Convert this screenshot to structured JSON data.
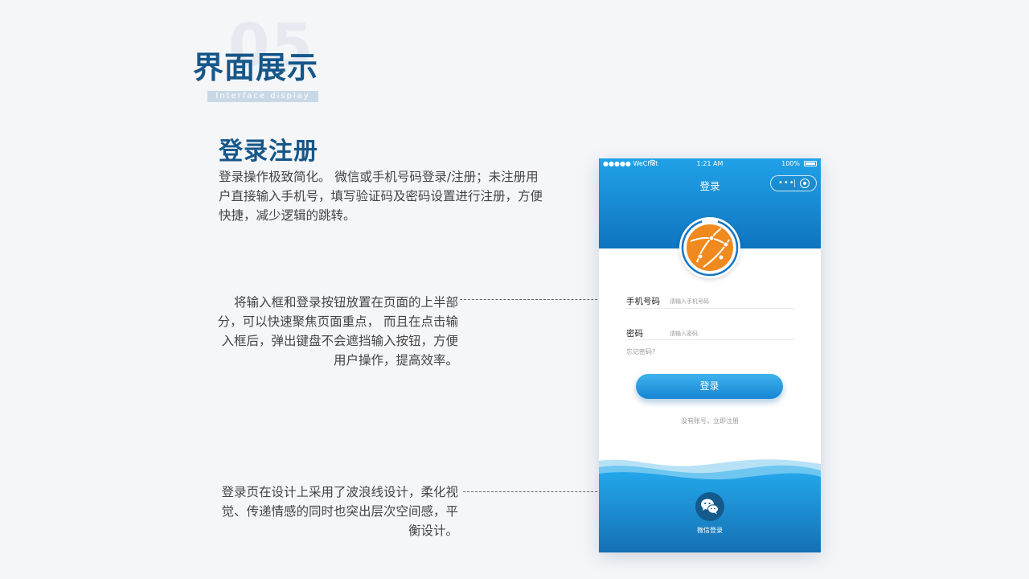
{
  "section": {
    "number": "05",
    "title": "界面展示",
    "subtitle": "Interface display"
  },
  "feature": {
    "title": "登录注册",
    "description": "登录操作极致简化。 微信或手机号码登录/注册；未注册用户直接输入手机号，填写验证码及密码设置进行注册，方便快捷，减少逻辑的跳转。"
  },
  "annotations": [
    {
      "text": "将输入框和登录按钮放置在页面的上半部分，可以快速聚焦页面重点， 而且在点击输入框后，弹出键盘不会遮挡输入按钮，方便用户操作，提高效率。"
    },
    {
      "text": "登录页在设计上采用了波浪线设计，柔化视觉、传递情感的同时也突出层次空间感，平衡设计。"
    }
  ],
  "phone": {
    "status_bar": {
      "carrier": "●●●●● WeChat",
      "time": "1:21 AM",
      "battery": "100%"
    },
    "nav_title": "登录",
    "capsule": {
      "more": "•••"
    },
    "form": {
      "phone_label": "手机号码",
      "phone_placeholder": "请输入手机号码",
      "password_label": "密码",
      "password_placeholder": "请输入密码",
      "forgot": "忘记密码?"
    },
    "login_button": "登录",
    "register_link": "没有账号，立即注册",
    "wechat_login": "微信登录"
  },
  "colors": {
    "accent": "#16578a",
    "header_gradient_top": "#21a2e8",
    "header_gradient_bottom": "#0f74bf",
    "avatar_orange": "#f08a1e"
  },
  "icons": [
    "wifi-icon",
    "battery-icon",
    "more-icon",
    "target-icon",
    "globe-avatar-icon",
    "wechat-icon"
  ]
}
